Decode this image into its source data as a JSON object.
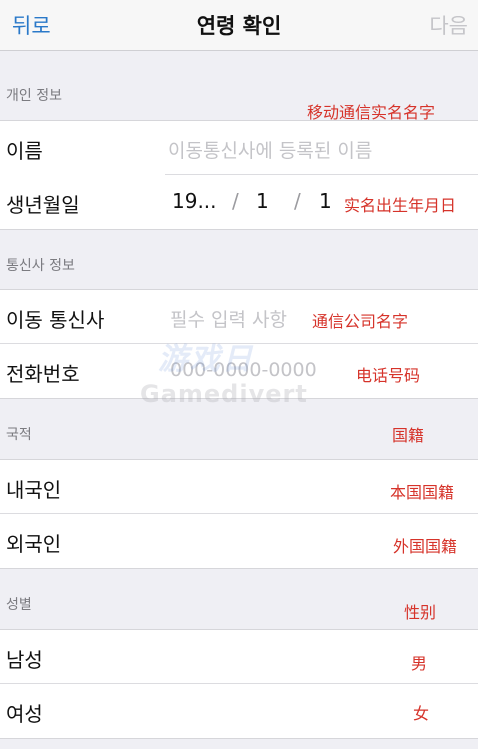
{
  "nav": {
    "back": "뒤로",
    "title": "연령 확인",
    "next": "다음"
  },
  "personal": {
    "header": "개인 정보",
    "header_note": "移动通信实名名字",
    "name_label": "이름",
    "name_placeholder": "이동통신사에 등록된 이름",
    "dob_label": "생년월일",
    "dob_year": "19...",
    "dob_sep": "/",
    "dob_month": "1",
    "dob_day": "1",
    "dob_note": "实名出生年月日"
  },
  "carrier": {
    "header": "통신사 정보",
    "carrier_label": "이동 통신사",
    "carrier_placeholder": "필수 입력 사항",
    "carrier_note": "通信公司名字",
    "phone_label": "전화번호",
    "phone_placeholder": "000-0000-0000",
    "phone_note": "电话号码"
  },
  "nationality": {
    "header": "국적",
    "header_note": "国籍",
    "options": [
      {
        "label": "내국인",
        "note": "本国国籍"
      },
      {
        "label": "외국인",
        "note": "外国国籍"
      }
    ]
  },
  "gender": {
    "header": "성별",
    "header_note": "性别",
    "options": [
      {
        "label": "남성",
        "note": "男"
      },
      {
        "label": "여성",
        "note": "女"
      }
    ]
  },
  "watermark": {
    "top": "游戏日",
    "bottom": "Gamedivert"
  },
  "colors": {
    "accent": "#2a79c9",
    "annotation": "#d6332a",
    "background": "#efeff4",
    "placeholder": "#c4c4c8"
  }
}
